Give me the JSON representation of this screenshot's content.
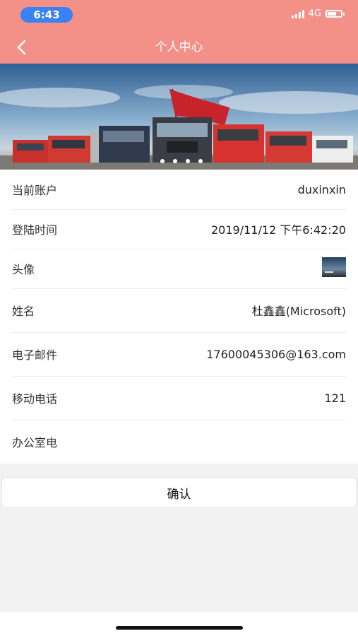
{
  "status_bar": {
    "time": "6:43",
    "network": "4G"
  },
  "nav": {
    "title": "个人中心",
    "back_icon": "chevron-left-icon"
  },
  "banner": {
    "description_icon": "truck-lineup-banner-image"
  },
  "profile": {
    "rows": [
      {
        "label": "当前账户",
        "value": "duxinxin"
      },
      {
        "label": "登陆时间",
        "value": "2019/11/12 下午6:42:20"
      },
      {
        "label": "头像",
        "value": ""
      },
      {
        "label": "姓名",
        "value": "杜鑫鑫(Microsoft)"
      },
      {
        "label": "电子邮件",
        "value": "17600045306@163.com"
      },
      {
        "label": "移动电话",
        "value": "121"
      },
      {
        "label": "办公室电",
        "value": ""
      }
    ]
  },
  "confirm_button": {
    "label": "确认"
  },
  "colors": {
    "header_bg": "#f39189",
    "time_pill": "#3b82f6"
  }
}
